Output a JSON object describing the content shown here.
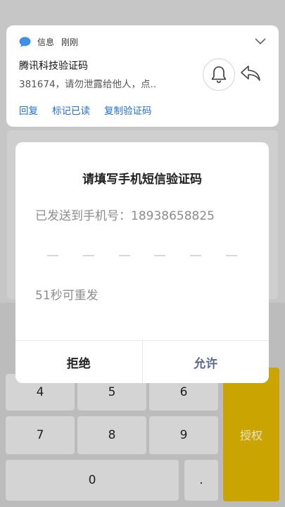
{
  "notification": {
    "app_name": "信息",
    "time": "刚刚",
    "title": "腾讯科技验证码",
    "body": "381674，请勿泄露给他人，点..",
    "actions": [
      "回复",
      "标记已读",
      "复制验证码"
    ],
    "accent_color": "#1e6fd9"
  },
  "dialog": {
    "title": "请填写手机短信验证码",
    "phone_label": "已发送到手机号：18938658825",
    "code_slots": 6,
    "resend_label": "51秒可重发",
    "refuse_label": "拒绝",
    "allow_label": "允许"
  },
  "keypad": {
    "keys": [
      "4",
      "5",
      "6",
      "7",
      "8",
      "9",
      "0",
      "."
    ],
    "auth_label": "授权",
    "auth_color": "#caa400"
  }
}
